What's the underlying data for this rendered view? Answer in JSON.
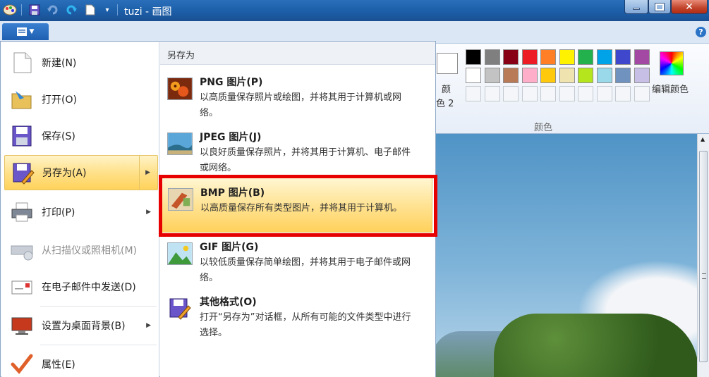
{
  "window": {
    "title": "tuzi - 画图",
    "title_bar_colors": {
      "close": "#c1422a"
    }
  },
  "ribbon": {
    "color1_label": "颜",
    "color2_label_line1": "颜",
    "color2_label_line2": "色 2",
    "edit_colors_label": "编辑颜色",
    "colors_group_label": "颜色",
    "help_label": "?",
    "palette_row1": [
      "#000000",
      "#7f7f7f",
      "#880015",
      "#ed1c24",
      "#ff7f27",
      "#fff200",
      "#22b14c",
      "#00a2e8",
      "#3f48cc",
      "#a349a4"
    ],
    "palette_row2": [
      "#ffffff",
      "#c3c3c3",
      "#b97a57",
      "#ffaec9",
      "#ffc90e",
      "#efe4b0",
      "#b5e61d",
      "#99d9ea",
      "#7092be",
      "#c8bfe7"
    ]
  },
  "app_menu": {
    "button_icon": "menu-icon",
    "items": [
      {
        "label": "新建(N)",
        "icon": "new-file-icon"
      },
      {
        "label": "打开(O)",
        "icon": "open-folder-icon"
      },
      {
        "label": "保存(S)",
        "icon": "save-icon"
      },
      {
        "label": "另存为(A)",
        "icon": "save-as-icon",
        "highlighted": true
      },
      {
        "label": "打印(P)",
        "icon": "printer-icon"
      },
      {
        "label": "从扫描仪或照相机(M)",
        "icon": "scanner-icon",
        "disabled": true
      },
      {
        "label": "在电子邮件中发送(D)",
        "icon": "email-icon"
      },
      {
        "label": "设置为桌面背景(B)",
        "icon": "desktop-background-icon"
      },
      {
        "label": "属性(E)",
        "icon": "checkmark-icon"
      }
    ]
  },
  "save_as_panel": {
    "heading": "另存为",
    "options": [
      {
        "title": "PNG 图片(P)",
        "desc": "以高质量保存照片或绘图，并将其用于计算机或网络。",
        "icon": "png-image-icon"
      },
      {
        "title": "JPEG 图片(J)",
        "desc": "以良好质量保存照片，并将其用于计算机、电子邮件或网络。",
        "icon": "jpeg-image-icon"
      },
      {
        "title": "BMP 图片(B)",
        "desc": "以高质量保存所有类型图片，并将其用于计算机。",
        "icon": "bmp-image-icon",
        "highlighted": true
      },
      {
        "title": "GIF 图片(G)",
        "desc": "以较低质量保存简单绘图，并将其用于电子邮件或网络。",
        "icon": "gif-image-icon"
      },
      {
        "title": "其他格式(O)",
        "desc": "打开“另存为”对话框，从所有可能的文件类型中进行选择。",
        "icon": "other-formats-icon"
      }
    ]
  }
}
